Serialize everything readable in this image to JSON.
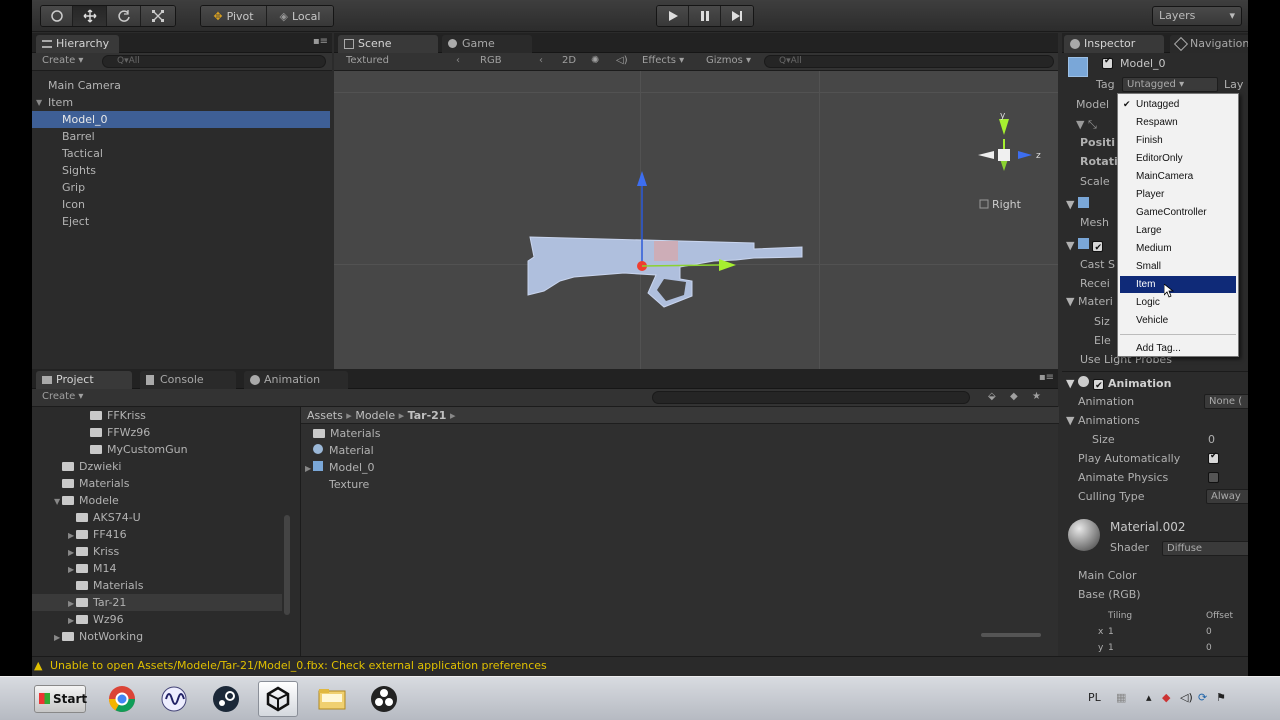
{
  "toolbar": {
    "pivot": "Pivot",
    "local": "Local",
    "layers": "Layers"
  },
  "hierarchy": {
    "tab": "Hierarchy",
    "create": "Create",
    "search_placeholder": "Q▾All",
    "items": [
      {
        "label": "Main Camera",
        "indent": 0,
        "selected": false
      },
      {
        "label": "Item",
        "indent": 0,
        "selected": false
      },
      {
        "label": "Model_0",
        "indent": 1,
        "selected": true
      },
      {
        "label": "Barrel",
        "indent": 1,
        "selected": false
      },
      {
        "label": "Tactical",
        "indent": 1,
        "selected": false
      },
      {
        "label": "Sights",
        "indent": 1,
        "selected": false
      },
      {
        "label": "Grip",
        "indent": 1,
        "selected": false
      },
      {
        "label": "Icon",
        "indent": 1,
        "selected": false
      },
      {
        "label": "Eject",
        "indent": 1,
        "selected": false
      }
    ]
  },
  "scene": {
    "tab_scene": "Scene",
    "tab_game": "Game",
    "shading": "Textured",
    "render_mode": "RGB",
    "mode_2d": "2D",
    "effects": "Effects",
    "gizmos": "Gizmos",
    "search": "Q▾All",
    "gizmo_y": "y",
    "gizmo_z": "z",
    "view_label": "Right"
  },
  "project": {
    "tab_project": "Project",
    "tab_console": "Console",
    "tab_animation": "Animation",
    "create": "Create",
    "tree": [
      {
        "label": "FFKriss",
        "depth": 3,
        "arrow": false,
        "selected": false
      },
      {
        "label": "FFWz96",
        "depth": 3,
        "arrow": false,
        "selected": false
      },
      {
        "label": "MyCustomGun",
        "depth": 3,
        "arrow": false,
        "selected": false
      },
      {
        "label": "Dzwieki",
        "depth": 1,
        "arrow": false,
        "selected": false
      },
      {
        "label": "Materials",
        "depth": 1,
        "arrow": false,
        "selected": false
      },
      {
        "label": "Modele",
        "depth": 1,
        "arrow": true,
        "open": true,
        "selected": false
      },
      {
        "label": "AKS74-U",
        "depth": 2,
        "arrow": false,
        "selected": false
      },
      {
        "label": "FF416",
        "depth": 2,
        "arrow": true,
        "selected": false
      },
      {
        "label": "Kriss",
        "depth": 2,
        "arrow": true,
        "selected": false
      },
      {
        "label": "M14",
        "depth": 2,
        "arrow": true,
        "selected": false
      },
      {
        "label": "Materials",
        "depth": 2,
        "arrow": false,
        "selected": false
      },
      {
        "label": "Tar-21",
        "depth": 2,
        "arrow": true,
        "selected": true
      },
      {
        "label": "Wz96",
        "depth": 2,
        "arrow": true,
        "selected": false
      },
      {
        "label": "NotWorking",
        "depth": 1,
        "arrow": true,
        "selected": false
      }
    ],
    "breadcrumb": [
      "Assets",
      "Modele",
      "Tar-21"
    ],
    "files": [
      "Materials",
      "Material",
      "Model_0",
      "Texture"
    ]
  },
  "inspector": {
    "tab_inspector": "Inspector",
    "tab_navigation": "Navigation",
    "object_name": "Model_0",
    "tag_label": "Tag",
    "tag_value": "Untagged",
    "layer_label": "Lay",
    "model_label": "Model",
    "position": "Positi",
    "rotation": "Rotati",
    "scale": "Scale",
    "mesh": "Mesh",
    "cast": "Cast S",
    "receive": "Recei",
    "materials": "Materi",
    "size_short": "Siz",
    "element_short": "Ele",
    "use_light_probes": "Use Light Probes",
    "animation_header": "Animation",
    "animation_label": "Animation",
    "animation_value": "None (",
    "animations_label": "Animations",
    "size_label": "Size",
    "size_value": "0",
    "play_auto": "Play Automatically",
    "animate_physics": "Animate Physics",
    "culling_type": "Culling Type",
    "culling_value": "Alway",
    "material_name": "Material.002",
    "shader_label": "Shader",
    "shader_value": "Diffuse",
    "main_color": "Main Color",
    "base_rgb": "Base (RGB)",
    "tiling": "Tiling",
    "offset": "Offset",
    "tiling_x_label": "x",
    "tiling_x_value": "1",
    "offset_x_value": "0",
    "tiling_y_label": "y",
    "tiling_y_value": "1",
    "offset_y_value": "0"
  },
  "tag_dropdown": {
    "items": [
      "Untagged",
      "Respawn",
      "Finish",
      "EditorOnly",
      "MainCamera",
      "Player",
      "GameController",
      "Large",
      "Medium",
      "Small",
      "Item",
      "Logic",
      "Vehicle"
    ],
    "checked": "Untagged",
    "highlighted": "Item",
    "add": "Add Tag..."
  },
  "status": {
    "message": "Unable to open Assets/Modele/Tar-21/Model_0.fbx: Check external application preferences"
  },
  "taskbar": {
    "start": "Start",
    "lang": "PL"
  },
  "colors": {
    "selection": "#3e5f96",
    "dropdown_highlight": "#0f2a78",
    "warning": "#e0c000"
  }
}
